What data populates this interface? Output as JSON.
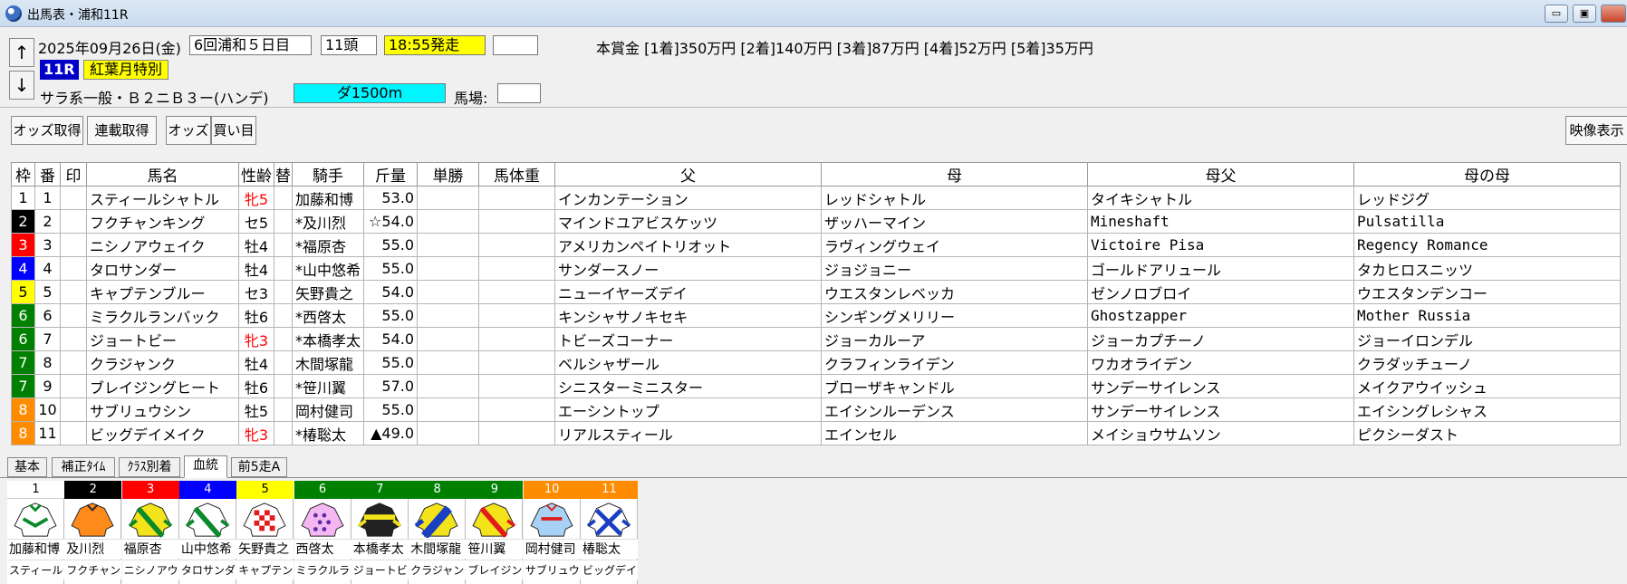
{
  "window": {
    "title": "出馬表・浦和11R",
    "minimize": "▭",
    "restore": "▣"
  },
  "header": {
    "up_arrow": "↑",
    "down_arrow": "↓",
    "date": "2025年09月26日(金)",
    "meeting": "6回浦和５日目",
    "runners": "11頭",
    "post_time": "18:55発走",
    "prize": "本賞金 [1着]350万円 [2着]140万円 [3着]87万円 [4着]52万円 [5着]35万円",
    "race_no": "11R",
    "race_name": "紅葉月特別",
    "conditions": "サラ系一般・Ｂ２ニＢ３ー(ハンデ)",
    "course": "ダ1500m",
    "going_label": "馬場:"
  },
  "toolbar": {
    "odds_fetch": "オッズ取得",
    "quinella_fetch": "連載取得",
    "odds": "オッズ",
    "bet": "買い目",
    "video": "映像表示"
  },
  "colors": {
    "waku": [
      "#ffffff",
      "#000000",
      "#ff0000",
      "#0000ff",
      "#ffff00",
      "#008000",
      "#008000",
      "#ff8c00",
      "#ff8c00",
      "#ff00ff",
      "#ff00ff"
    ]
  },
  "table": {
    "headers": [
      "枠",
      "番",
      "印",
      "馬名",
      "性齢",
      "替",
      "騎手",
      "斤量",
      "単勝",
      "馬体重",
      "父",
      "母",
      "母父",
      "母の母"
    ],
    "rows": [
      {
        "waku": "1",
        "num": "1",
        "name": "スティールシャトル",
        "sex": "牝5",
        "f": true,
        "jockey": "加藤和博",
        "weight": "53.0",
        "sire": "インカンテーション",
        "dam": "レッドシャトル",
        "bms": "タイキシャトル",
        "gdam": "レッドジグ"
      },
      {
        "waku": "2",
        "num": "2",
        "name": "フクチャンキング",
        "sex": "セ5",
        "f": false,
        "jockey": "*及川烈",
        "weight": "☆54.0",
        "sire": "マインドユアビスケッツ",
        "dam": "ザッハーマイン",
        "bms": "Mineshaft",
        "gdam": "Pulsatilla"
      },
      {
        "waku": "3",
        "num": "3",
        "name": "ニシノアウェイク",
        "sex": "牡4",
        "f": false,
        "jockey": "*福原杏",
        "weight": "55.0",
        "sire": "アメリカンペイトリオット",
        "dam": "ラヴィングウェイ",
        "bms": "Victoire Pisa",
        "gdam": "Regency Romance"
      },
      {
        "waku": "4",
        "num": "4",
        "name": "タロサンダー",
        "sex": "牡4",
        "f": false,
        "jockey": "*山中悠希",
        "weight": "55.0",
        "sire": "サンダースノー",
        "dam": "ジョジョニー",
        "bms": "ゴールドアリュール",
        "gdam": "タカヒロスニッツ"
      },
      {
        "waku": "5",
        "num": "5",
        "name": "キャプテンブルー",
        "sex": "セ3",
        "f": false,
        "jockey": "矢野貴之",
        "weight": "54.0",
        "sire": "ニューイヤーズデイ",
        "dam": "ウエスタンレベッカ",
        "bms": "ゼンノロブロイ",
        "gdam": "ウエスタンデンコー"
      },
      {
        "waku": "6",
        "num": "6",
        "name": "ミラクルランバック",
        "sex": "牡6",
        "f": false,
        "jockey": "*西啓太",
        "weight": "55.0",
        "sire": "キンシャサノキセキ",
        "dam": "シンギングメリリー",
        "bms": "Ghostzapper",
        "gdam": "Mother Russia"
      },
      {
        "waku": "6",
        "num": "7",
        "name": "ジョートビー",
        "sex": "牝3",
        "f": true,
        "jockey": "*本橋孝太",
        "weight": "54.0",
        "sire": "トビーズコーナー",
        "dam": "ジョーカルーア",
        "bms": "ジョーカプチーノ",
        "gdam": "ジョーイロンデル"
      },
      {
        "waku": "7",
        "num": "8",
        "name": "クラジャンク",
        "sex": "牡4",
        "f": false,
        "jockey": "木間塚龍",
        "weight": "55.0",
        "sire": "ベルシャザール",
        "dam": "クラフィンライデン",
        "bms": "ワカオライデン",
        "gdam": "クラダッチューノ"
      },
      {
        "waku": "7",
        "num": "9",
        "name": "ブレイジングヒート",
        "sex": "牡6",
        "f": false,
        "jockey": "*笹川翼",
        "weight": "57.0",
        "sire": "シニスターミニスター",
        "dam": "ブローザキャンドル",
        "bms": "サンデーサイレンス",
        "gdam": "メイクアウイッシュ"
      },
      {
        "waku": "8",
        "num": "10",
        "name": "サブリュウシン",
        "sex": "牡5",
        "f": false,
        "jockey": "岡村健司",
        "weight": "55.0",
        "sire": "エーシントップ",
        "dam": "エイシンルーデンス",
        "bms": "サンデーサイレンス",
        "gdam": "エイシングレシャス"
      },
      {
        "waku": "8",
        "num": "11",
        "name": "ビッグデイメイク",
        "sex": "牝3",
        "f": true,
        "jockey": "*椿聡太",
        "weight": "▲49.0",
        "sire": "リアルスティール",
        "dam": "エインセル",
        "bms": "メイショウサムソン",
        "gdam": "ピクシーダスト"
      }
    ]
  },
  "tabs": [
    "基本",
    "補正ﾀｲﾑ",
    "ｸﾗｽ別着",
    "血統",
    "前5走A"
  ],
  "silks": [
    {
      "num": "1",
      "jockey": "加藤和博",
      "horse": "スティールシャトル"
    },
    {
      "num": "2",
      "jockey": "及川烈",
      "horse": "フクチャンキング"
    },
    {
      "num": "3",
      "jockey": "福原杏",
      "horse": "ニシノアウェイク"
    },
    {
      "num": "4",
      "jockey": "山中悠希",
      "horse": "タロサンダー"
    },
    {
      "num": "5",
      "jockey": "矢野貴之",
      "horse": "キャプテンブルー"
    },
    {
      "num": "6",
      "jockey": "西啓太",
      "horse": "ミラクルランバック"
    },
    {
      "num": "7",
      "jockey": "本橋孝太",
      "horse": "ジョートビー"
    },
    {
      "num": "8",
      "jockey": "木間塚龍",
      "horse": "クラジャンク"
    },
    {
      "num": "9",
      "jockey": "笹川翼",
      "horse": "ブレイジングヒート"
    },
    {
      "num": "10",
      "jockey": "岡村健司",
      "horse": "サブリュウシン"
    },
    {
      "num": "11",
      "jockey": "椿聡太",
      "horse": "ビッグデイメイク"
    }
  ]
}
